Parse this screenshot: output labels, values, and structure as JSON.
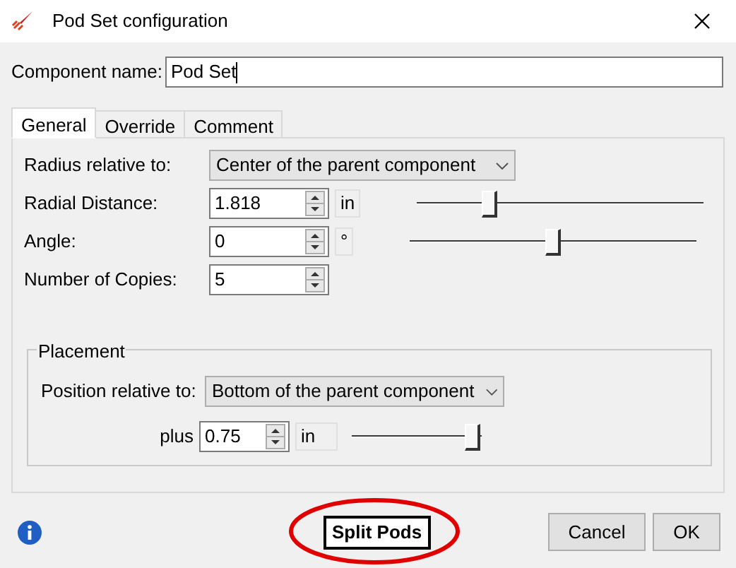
{
  "window": {
    "title": "Pod Set configuration"
  },
  "component_name": {
    "label": "Component name:",
    "value": "Pod Set"
  },
  "tabs": [
    {
      "label": "General",
      "selected": true
    },
    {
      "label": "Override",
      "selected": false
    },
    {
      "label": "Comment",
      "selected": false
    }
  ],
  "general": {
    "radius_relative_to": {
      "label": "Radius relative to:",
      "value": "Center of the parent component"
    },
    "rows": [
      {
        "label": "Radial Distance:",
        "value": "1.818",
        "unit": "in",
        "level": 0.24
      },
      {
        "label": "Angle:",
        "value": "0",
        "unit": "°",
        "level": 0.5
      },
      {
        "label": "Number of Copies:",
        "value": "5"
      }
    ]
  },
  "placement": {
    "title": "Placement",
    "position_label": "Position relative to:",
    "position_value": "Bottom of the parent component",
    "plus_label": "plus",
    "plus_value": "0.75",
    "plus_unit": "in",
    "level": 1
  },
  "buttons": {
    "split": "Split Pods",
    "cancel": "Cancel",
    "ok": "OK"
  }
}
